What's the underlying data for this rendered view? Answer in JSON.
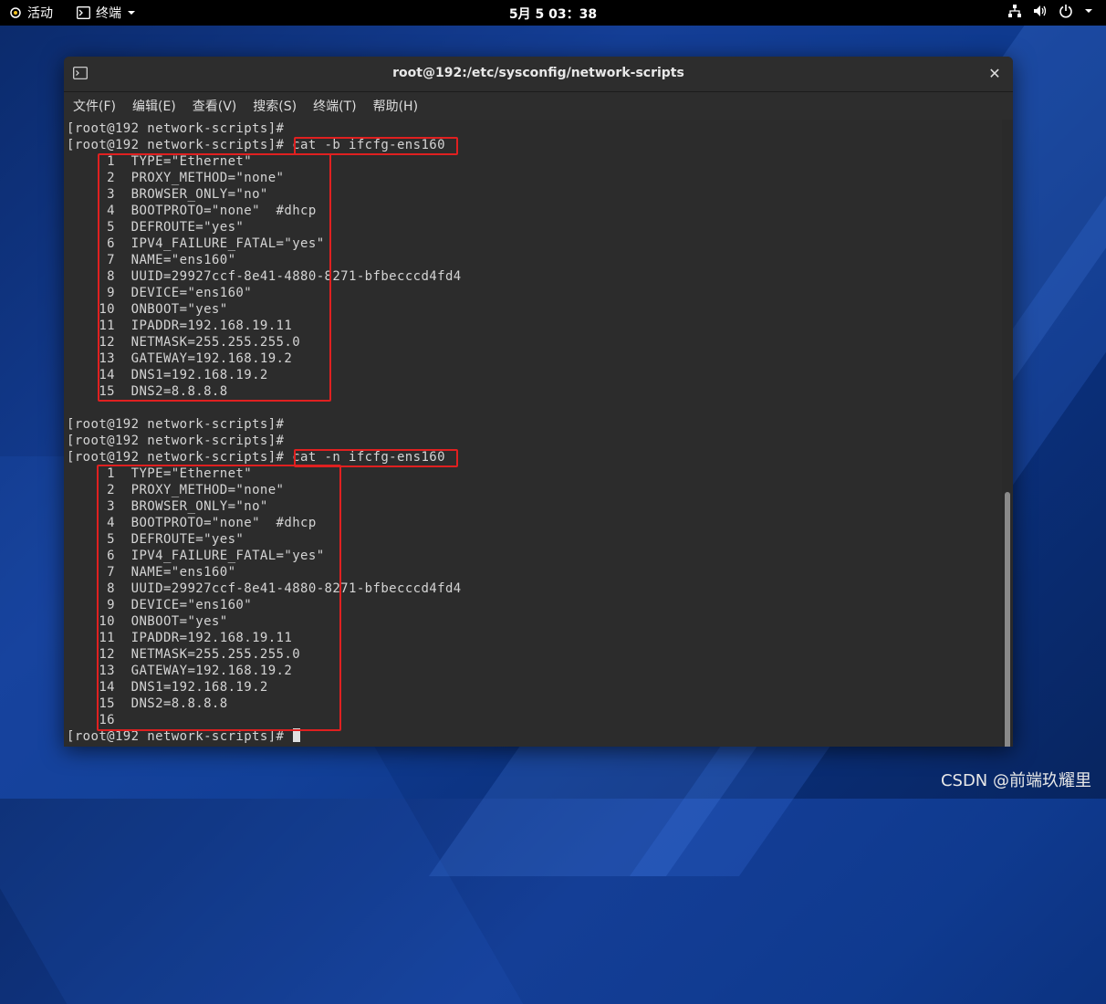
{
  "topbar": {
    "activities": "活动",
    "app_menu": "终端",
    "clock": "5月 5 03：38"
  },
  "window": {
    "title": "root@192:/etc/sysconfig/network-scripts",
    "menu": [
      "文件(F)",
      "编辑(E)",
      "查看(V)",
      "搜索(S)",
      "终端(T)",
      "帮助(H)"
    ]
  },
  "terminal": {
    "lines": [
      "[root@192 network-scripts]#",
      "[root@192 network-scripts]# cat -b ifcfg-ens160",
      "     1\tTYPE=\"Ethernet\"",
      "     2\tPROXY_METHOD=\"none\"",
      "     3\tBROWSER_ONLY=\"no\"",
      "     4\tBOOTPROTO=\"none\"  #dhcp",
      "     5\tDEFROUTE=\"yes\"",
      "     6\tIPV4_FAILURE_FATAL=\"yes\"",
      "     7\tNAME=\"ens160\"",
      "     8\tUUID=29927ccf-8e41-4880-8271-bfbecccd4fd4",
      "     9\tDEVICE=\"ens160\"",
      "    10\tONBOOT=\"yes\"",
      "    11\tIPADDR=192.168.19.11",
      "    12\tNETMASK=255.255.255.0",
      "    13\tGATEWAY=192.168.19.2",
      "    14\tDNS1=192.168.19.2",
      "    15\tDNS2=8.8.8.8",
      "",
      "[root@192 network-scripts]#",
      "[root@192 network-scripts]#",
      "[root@192 network-scripts]# cat -n ifcfg-ens160",
      "     1\tTYPE=\"Ethernet\"",
      "     2\tPROXY_METHOD=\"none\"",
      "     3\tBROWSER_ONLY=\"no\"",
      "     4\tBOOTPROTO=\"none\"  #dhcp",
      "     5\tDEFROUTE=\"yes\"",
      "     6\tIPV4_FAILURE_FATAL=\"yes\"",
      "     7\tNAME=\"ens160\"",
      "     8\tUUID=29927ccf-8e41-4880-8271-bfbecccd4fd4",
      "     9\tDEVICE=\"ens160\"",
      "    10\tONBOOT=\"yes\"",
      "    11\tIPADDR=192.168.19.11",
      "    12\tNETMASK=255.255.255.0",
      "    13\tGATEWAY=192.168.19.2",
      "    14\tDNS1=192.168.19.2",
      "    15\tDNS2=8.8.8.8",
      "    16\t"
    ],
    "prompt": "[root@192 network-scripts]# "
  },
  "watermark": "CSDN @前端玖耀里",
  "colors": {
    "highlight": "#e02020",
    "terminal_bg": "#2c2c2c",
    "terminal_fg": "#d4d4d4"
  },
  "icons": [
    "activities-icon",
    "terminal-icon",
    "chevron-down-icon",
    "network-icon",
    "volume-icon",
    "power-icon",
    "close-icon"
  ]
}
